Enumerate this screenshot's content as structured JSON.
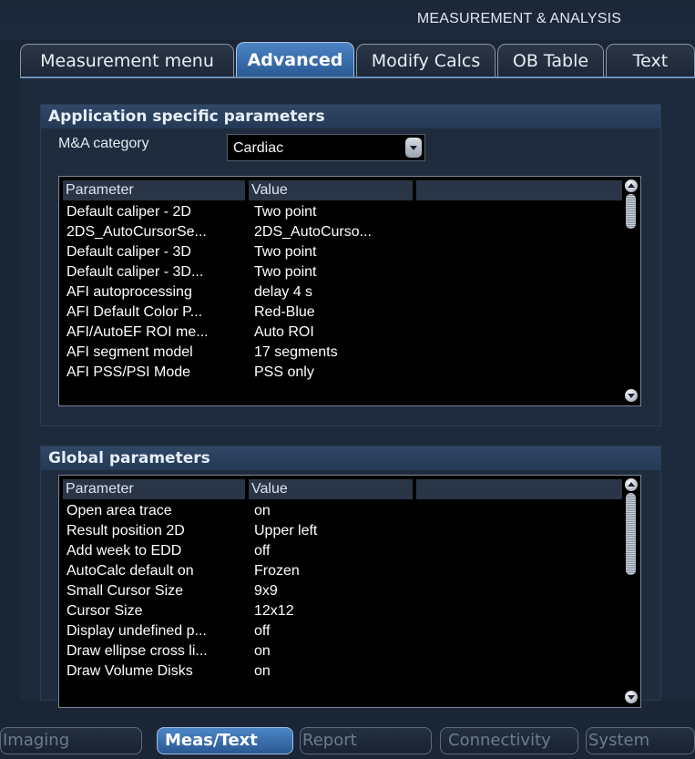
{
  "header": {
    "title": "MEASUREMENT & ANALYSIS"
  },
  "tabs": [
    {
      "label": "Measurement menu",
      "active": false
    },
    {
      "label": "Advanced",
      "active": true
    },
    {
      "label": "Modify Calcs",
      "active": false
    },
    {
      "label": "OB Table",
      "active": false
    },
    {
      "label": "Text",
      "active": false
    }
  ],
  "app_section": {
    "title": "Application specific parameters",
    "category_label": "M&A category",
    "category_value": "Cardiac",
    "columns": [
      "Parameter",
      "Value"
    ],
    "rows": [
      [
        "Default caliper - 2D",
        "Two point"
      ],
      [
        "2DS_AutoCursorSe...",
        "2DS_AutoCurso..."
      ],
      [
        "Default caliper - 3D",
        "Two point"
      ],
      [
        "Default caliper - 3D...",
        "Two point"
      ],
      [
        "AFI autoprocessing",
        "delay 4 s"
      ],
      [
        "AFI Default Color P...",
        "Red-Blue"
      ],
      [
        "AFI/AutoEF ROI me...",
        "Auto ROI"
      ],
      [
        "AFI segment model",
        "17 segments"
      ],
      [
        "AFI PSS/PSI Mode",
        "PSS only"
      ]
    ]
  },
  "global_section": {
    "title": "Global parameters",
    "columns": [
      "Parameter",
      "Value"
    ],
    "rows": [
      [
        "Open area trace",
        "on"
      ],
      [
        "Result position 2D",
        "Upper left"
      ],
      [
        "Add week to EDD",
        "off"
      ],
      [
        "AutoCalc default on",
        "Frozen"
      ],
      [
        "Small Cursor Size",
        "9x9"
      ],
      [
        "Cursor Size",
        "12x12"
      ],
      [
        "Display undefined p...",
        "off"
      ],
      [
        "Draw ellipse cross li...",
        "on"
      ],
      [
        "Draw Volume Disks",
        "on"
      ]
    ]
  },
  "bottom_tabs": [
    {
      "label": "Imaging",
      "active": false
    },
    {
      "label": "Meas/Text",
      "active": true
    },
    {
      "label": "Report",
      "active": false
    },
    {
      "label": "Connectivity",
      "active": false
    },
    {
      "label": "System",
      "active": false
    }
  ],
  "colors": {
    "accent": "#3f76b8",
    "background": "#1a2535",
    "table_bg": "#000000"
  },
  "icons": {
    "dropdown": "chevron-down-icon",
    "scroll_up": "scroll-up-icon",
    "scroll_down": "scroll-down-icon"
  }
}
